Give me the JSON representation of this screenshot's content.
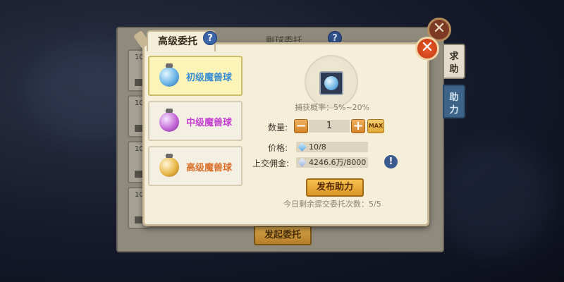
{
  "back_panel": {
    "title": "剿球委托",
    "help": "?",
    "list_numbers": [
      "10",
      "10",
      "10",
      "10"
    ],
    "close": "✕",
    "start_button": "发起委托"
  },
  "side_tabs": [
    {
      "label": "求\n助"
    },
    {
      "label": "助\n力"
    }
  ],
  "front_panel": {
    "tab_title": "高级委托",
    "help": "?",
    "close": "✕",
    "balls": [
      {
        "label": "初级魔兽球",
        "color": "#3a8ed4",
        "selected": true
      },
      {
        "label": "中级魔兽球",
        "color": "#c440d0",
        "selected": false
      },
      {
        "label": "高级魔兽球",
        "color": "#d8702a",
        "selected": false
      }
    ],
    "catch_rate": "捕获概率：5%~20%",
    "quantity_label": "数量:",
    "quantity_minus": "−",
    "quantity_value": "1",
    "quantity_plus": "+",
    "quantity_max": "MAX",
    "price_label": "价格:",
    "price_value": "10/8",
    "commission_label": "上交佣金:",
    "commission_value": "4246.6万/8000",
    "warning": "!",
    "publish_button": "发布助力",
    "remaining_text": "今日剩余提交委托次数：5/5"
  }
}
